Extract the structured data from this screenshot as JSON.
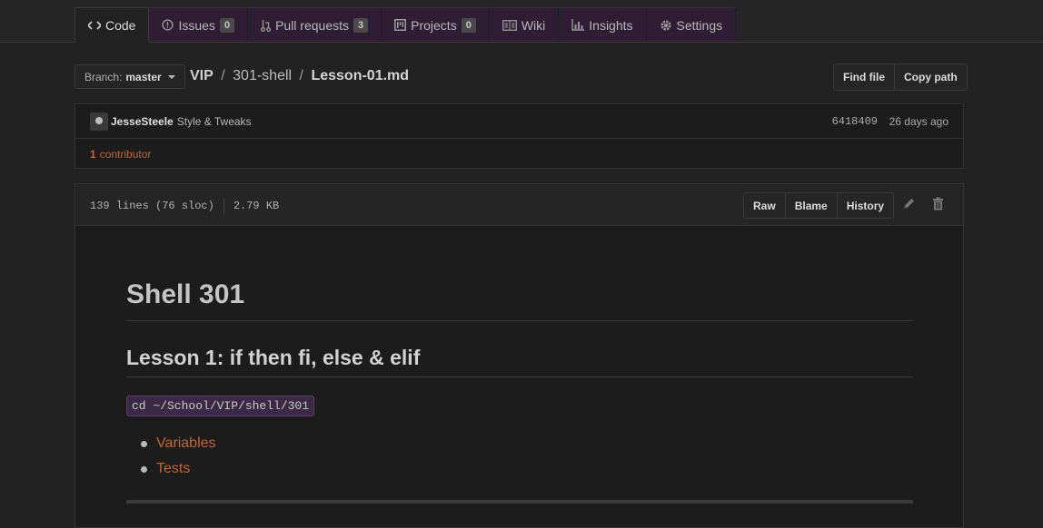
{
  "tabs": [
    {
      "label": "Code",
      "icon": "code-icon",
      "counter": null,
      "selected": true
    },
    {
      "label": "Issues",
      "icon": "issue-icon",
      "counter": "0",
      "selected": false
    },
    {
      "label": "Pull requests",
      "icon": "pull-request-icon",
      "counter": "3",
      "selected": false
    },
    {
      "label": "Projects",
      "icon": "project-icon",
      "counter": "0",
      "selected": false
    },
    {
      "label": "Wiki",
      "icon": "book-icon",
      "counter": null,
      "selected": false
    },
    {
      "label": "Insights",
      "icon": "graph-icon",
      "counter": null,
      "selected": false
    },
    {
      "label": "Settings",
      "icon": "gear-icon",
      "counter": null,
      "selected": false
    }
  ],
  "branch": {
    "prefix": "Branch:",
    "name": "master"
  },
  "breadcrumb": {
    "root": "VIP",
    "sep1": "/",
    "folder": "301-shell",
    "sep2": "/",
    "file": "Lesson-01.md"
  },
  "file_actions": {
    "find_file": "Find file",
    "copy_path": "Copy path"
  },
  "commit": {
    "author": "JesseSteele",
    "message": "Style & Tweaks",
    "sha": "6418409",
    "ago": "26 days ago"
  },
  "contributors": {
    "count": "1",
    "label": "contributor"
  },
  "file_info": {
    "lines": "139 lines (76 sloc)",
    "size": "2.79 KB"
  },
  "file_buttons": {
    "raw": "Raw",
    "blame": "Blame",
    "history": "History"
  },
  "content": {
    "h1": "Shell 301",
    "h2": "Lesson 1: if then fi, else & elif",
    "code": "cd ~/School/VIP/shell/301",
    "links": [
      "Variables",
      "Tests"
    ]
  },
  "colors": {
    "accent": "#c2662d",
    "tab_background": "#2f1d33",
    "code_background": "#3b2a45"
  }
}
